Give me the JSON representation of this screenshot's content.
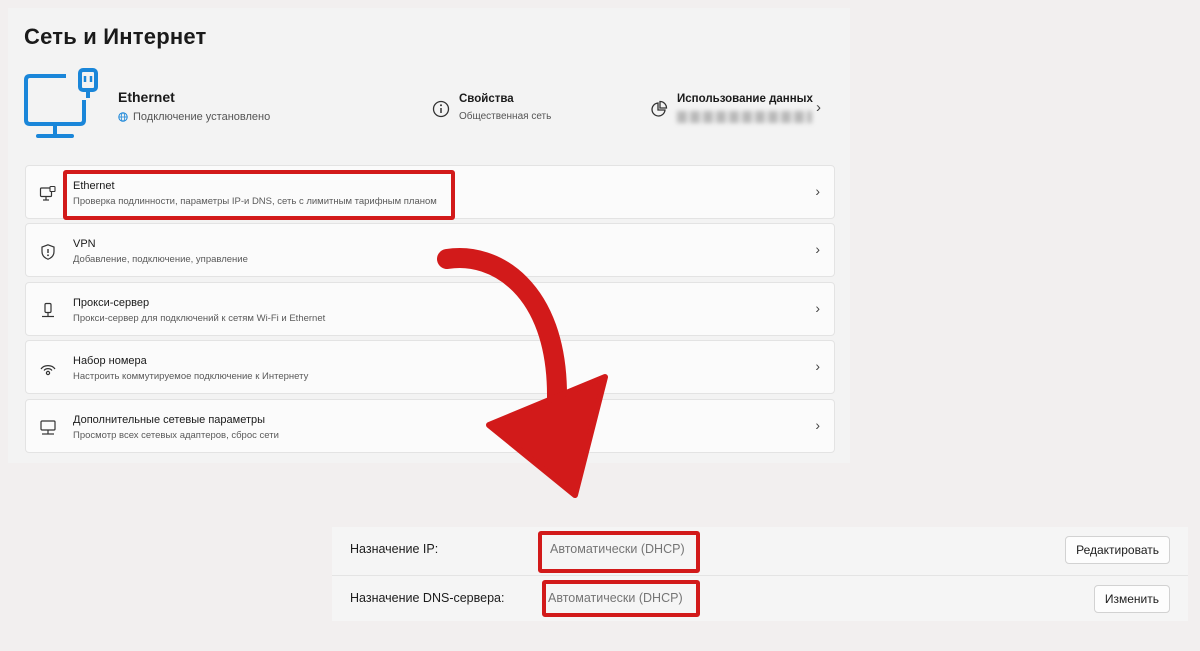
{
  "page": {
    "title": "Сеть и Интернет"
  },
  "hero": {
    "connection_name": "Ethernet",
    "connection_status": "Подключение установлено",
    "properties": {
      "label": "Свойства",
      "sub": "Общественная сеть"
    },
    "data_usage": {
      "label": "Использование данных"
    }
  },
  "rows": [
    {
      "title": "Ethernet",
      "desc": "Проверка подлинности, параметры IP-и DNS, сеть с лимитным тарифным планом",
      "icon": "ethernet-monitor-icon"
    },
    {
      "title": "VPN",
      "desc": "Добавление, подключение, управление",
      "icon": "shield-icon"
    },
    {
      "title": "Прокси-сервер",
      "desc": "Прокси-сервер для подключений к сетям Wi-Fi и Ethernet",
      "icon": "proxy-server-icon"
    },
    {
      "title": "Набор номера",
      "desc": "Настроить коммутируемое подключение к Интернету",
      "icon": "dialup-icon"
    },
    {
      "title": "Дополнительные сетевые параметры",
      "desc": "Просмотр всех сетевых адаптеров, сброс сети",
      "icon": "network-adapter-icon"
    }
  ],
  "ip_settings": {
    "ip_assignment": {
      "label": "Назначение IP:",
      "value": "Автоматически (DHCP)",
      "button": "Редактировать"
    },
    "dns_assignment": {
      "label": "Назначение DNS-сервера:",
      "value": "Автоматически (DHCP)",
      "button": "Изменить"
    }
  },
  "colors": {
    "accent": "#1a86d9",
    "highlight": "#d21a1a",
    "background": "#f2efef"
  }
}
